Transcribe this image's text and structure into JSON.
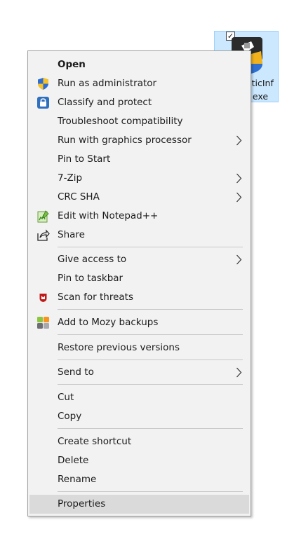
{
  "desktop_icon": {
    "label_line1": "sticInf",
    "label_line2": "exe"
  },
  "menu": {
    "items": [
      {
        "label": "Open",
        "icon": "none",
        "submenu": false
      },
      {
        "label": "Run as administrator",
        "icon": "uac-shield-icon",
        "submenu": false
      },
      {
        "label": "Classify and protect",
        "icon": "lock-icon",
        "submenu": false
      },
      {
        "label": "Troubleshoot compatibility",
        "icon": "none",
        "submenu": false
      },
      {
        "label": "Run with graphics processor",
        "icon": "none",
        "submenu": true
      },
      {
        "label": "Pin to Start",
        "icon": "none",
        "submenu": false
      },
      {
        "label": "7-Zip",
        "icon": "none",
        "submenu": true
      },
      {
        "label": "CRC SHA",
        "icon": "none",
        "submenu": true
      },
      {
        "label": "Edit with Notepad++",
        "icon": "notepad-icon",
        "submenu": false
      },
      {
        "label": "Share",
        "icon": "share-icon",
        "submenu": false
      },
      {
        "label": "Give access to",
        "icon": "none",
        "submenu": true
      },
      {
        "label": "Pin to taskbar",
        "icon": "none",
        "submenu": false
      },
      {
        "label": "Scan for threats",
        "icon": "mcafee-shield-icon",
        "submenu": false
      },
      {
        "label": "Add to Mozy backups",
        "icon": "mozy-icon",
        "submenu": false
      },
      {
        "label": "Restore previous versions",
        "icon": "none",
        "submenu": false
      },
      {
        "label": "Send to",
        "icon": "none",
        "submenu": true
      },
      {
        "label": "Cut",
        "icon": "none",
        "submenu": false
      },
      {
        "label": "Copy",
        "icon": "none",
        "submenu": false
      },
      {
        "label": "Create shortcut",
        "icon": "none",
        "submenu": false
      },
      {
        "label": "Delete",
        "icon": "none",
        "submenu": false
      },
      {
        "label": "Rename",
        "icon": "none",
        "submenu": false
      },
      {
        "label": "Properties",
        "icon": "none",
        "submenu": false,
        "highlighted": true
      }
    ]
  },
  "colors": {
    "menu_background": "#f2f2f2",
    "hover_background": "#dadada",
    "selection_blue": "#cce8ff"
  }
}
